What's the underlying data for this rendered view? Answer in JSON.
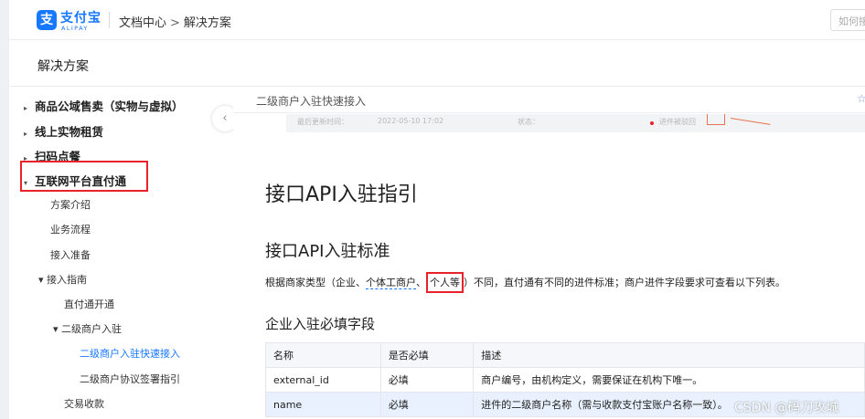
{
  "header": {
    "logo_mark": "支",
    "logo_cn": "支付宝",
    "logo_en": "ALIPAY",
    "crumb_root": "文档中心",
    "crumb_sep": ">",
    "crumb_current": "解决方案",
    "search_placeholder": "如何接"
  },
  "solutions_title": "解决方案",
  "sidebar": {
    "collapse_glyph": "‹",
    "top_items": [
      {
        "caret": "▸",
        "label": "商品公域售卖（实物与虚拟）"
      },
      {
        "caret": "▸",
        "label": "线上实物租赁"
      },
      {
        "caret": "▸",
        "label": "扫码点餐"
      },
      {
        "caret": "▾",
        "label": "互联网平台直付通"
      }
    ],
    "sub_items": [
      {
        "label": "方案介绍"
      },
      {
        "label": "业务流程"
      },
      {
        "label": "接入准备"
      },
      {
        "label": "▾ 接入指南"
      },
      {
        "label": "直付通开通"
      },
      {
        "label": "▾ 二级商户入驻"
      },
      {
        "label": "二级商户入驻快速接入"
      },
      {
        "label": "二级商户协议签署指引"
      },
      {
        "label": "交易收款"
      }
    ]
  },
  "content": {
    "doc_title": "二级商户入驻快速接入",
    "star_icon": "☆",
    "strip_texts": [
      "最后更新时间：",
      "2022-05-10 17:02",
      "状态：",
      "进件被驳回"
    ],
    "h1": "接口API入驻指引",
    "h2": "接口API入驻标准",
    "para_prefix": "根据商家类型（企业、",
    "para_link1": "个体工商户",
    "para_mid": "、",
    "para_link2": "个人等",
    "para_suffix": "）不同，直付通有不同的进件标准；商户进件字段要求可查看以下列表。",
    "h3": "企业入驻必填字段",
    "table": {
      "headers": [
        "名称",
        "是否必填",
        "描述"
      ],
      "rows": [
        [
          "external_id",
          "必填",
          "商户编号，由机构定义，需要保证在机构下唯一。"
        ],
        [
          "name",
          "必填",
          "进件的二级商户名称（需与收款支付宝账户名称一致）。"
        ]
      ]
    }
  },
  "watermark": "CSDN @码刀攻城",
  "colors": {
    "accent": "#1677ff",
    "highlight_red": "#e8212b"
  }
}
